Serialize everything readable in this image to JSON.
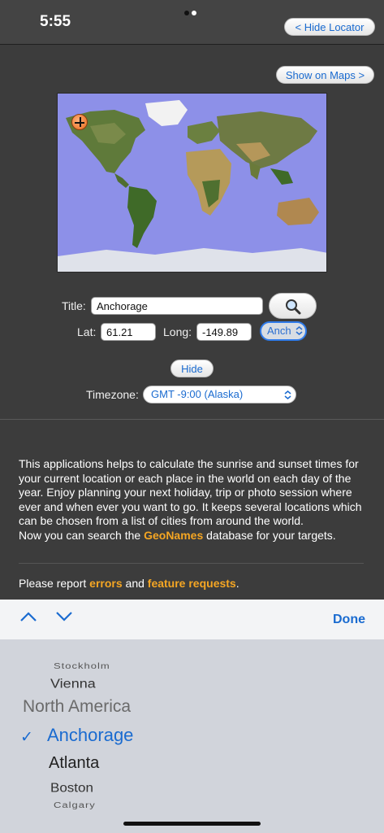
{
  "status": {
    "time": "5:55"
  },
  "nav": {
    "hide_locator": "< Hide Locator",
    "show_on_maps": "Show on Maps >"
  },
  "locator": {
    "title_label": "Title:",
    "title_value": "Anchorage",
    "lat_label": "Lat:",
    "lat_value": "61.21",
    "long_label": "Long:",
    "long_value": "-149.89",
    "city_select": "Anch",
    "hide_label": "Hide",
    "timezone_label": "Timezone:",
    "timezone_value": "GMT -9:00 (Alaska)"
  },
  "description": {
    "text_1": "This applications helps to calculate the sunrise and sunset times for your current location or each place in the world on each day of the year. Enjoy planning your next holiday, trip or photo session where ever and when ever you want to go. It keeps several locations which can be chosen from a list of cities from around the world.",
    "text_2a": "Now you can search the ",
    "geonames": "GeoNames",
    "text_2b": " database for your targets.",
    "report_a": "Please report ",
    "errors": "errors",
    "report_and": " and ",
    "feature_requests": "feature requests",
    "report_end": "."
  },
  "toolbar": {
    "done": "Done"
  },
  "picker": {
    "items": [
      "Stockholm",
      "Vienna",
      "North America",
      "Anchorage",
      "Atlanta",
      "Boston",
      "Calgary"
    ],
    "selected": "Anchorage",
    "checkmark": "✓"
  },
  "colors": {
    "accent": "#1a6bd0",
    "highlight": "#f5a623",
    "map_water": "#8d90e8"
  }
}
